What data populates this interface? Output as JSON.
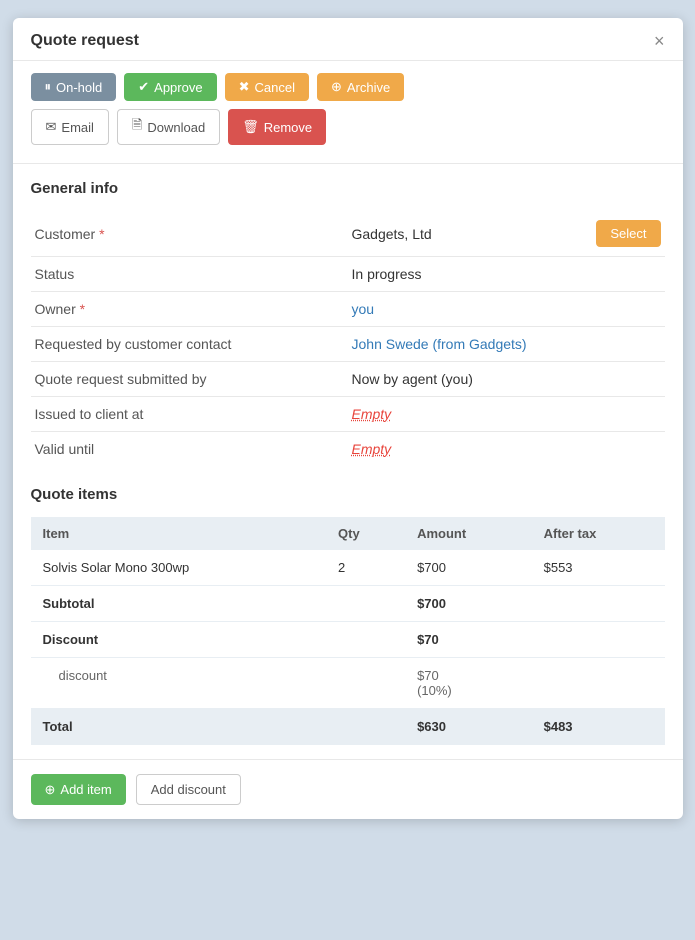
{
  "modal": {
    "title": "Quote request",
    "close_label": "×"
  },
  "toolbar": {
    "buttons": [
      {
        "id": "onhold",
        "label": "On-hold",
        "icon": "pause-icon",
        "style": "onhold"
      },
      {
        "id": "approve",
        "label": "Approve",
        "icon": "check-icon",
        "style": "approve"
      },
      {
        "id": "cancel",
        "label": "Cancel",
        "icon": "times-icon",
        "style": "cancel"
      },
      {
        "id": "archive",
        "label": "Archive",
        "icon": "archive-icon",
        "style": "archive"
      }
    ],
    "action_buttons": [
      {
        "id": "email",
        "label": "Email",
        "icon": "envelope-icon",
        "style": "email"
      },
      {
        "id": "download",
        "label": "Download",
        "icon": "file-icon",
        "style": "download"
      },
      {
        "id": "remove",
        "label": "Remove",
        "icon": "trash-icon",
        "style": "remove"
      }
    ]
  },
  "general_info": {
    "title": "General info",
    "fields": [
      {
        "label": "Customer",
        "required": true,
        "value": "Gadgets, Ltd",
        "has_select": true
      },
      {
        "label": "Status",
        "required": false,
        "value": "In progress",
        "type": "text"
      },
      {
        "label": "Owner",
        "required": true,
        "value": "you",
        "type": "link"
      },
      {
        "label": "Requested by customer contact",
        "required": false,
        "value": "John Swede (from Gadgets)",
        "type": "link"
      },
      {
        "label": "Quote request submitted by",
        "required": false,
        "value": "Now by agent (you)",
        "type": "text"
      },
      {
        "label": "Issued to client at",
        "required": false,
        "value": "Empty",
        "type": "empty"
      },
      {
        "label": "Valid until",
        "required": false,
        "value": "Empty",
        "type": "empty"
      }
    ],
    "select_label": "Select"
  },
  "quote_items": {
    "title": "Quote items",
    "columns": [
      "Item",
      "Qty",
      "Amount",
      "After tax"
    ],
    "items": [
      {
        "name": "Solvis Solar Mono 300wp",
        "qty": "2",
        "amount": "$700",
        "after_tax": "$553"
      }
    ],
    "subtotal_label": "Subtotal",
    "subtotal_amount": "$700",
    "discount_label": "Discount",
    "discount_amount": "$70",
    "discount_detail_name": "discount",
    "discount_detail_amount": "$70\n(10%)",
    "total_label": "Total",
    "total_amount": "$630",
    "total_after_tax": "$483"
  },
  "footer": {
    "add_item_label": "Add item",
    "add_discount_label": "Add discount"
  }
}
